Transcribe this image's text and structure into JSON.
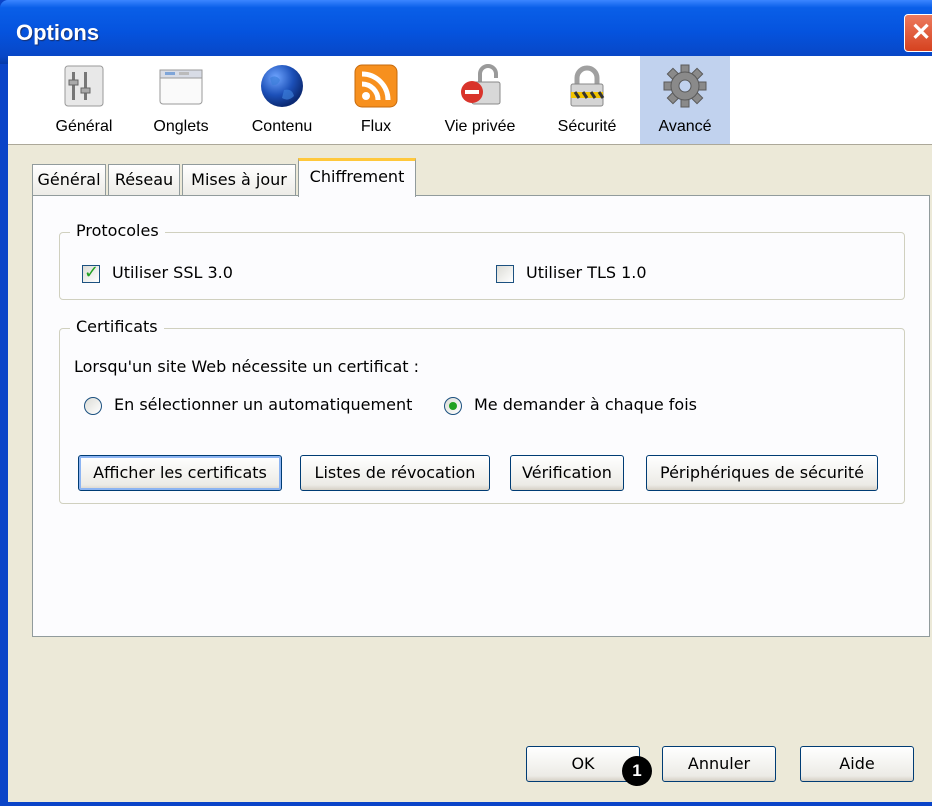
{
  "window": {
    "title": "Options",
    "close_label": "✕"
  },
  "toolbar": {
    "items": [
      {
        "label": "Général",
        "icon": "general-icon"
      },
      {
        "label": "Onglets",
        "icon": "tabs-icon"
      },
      {
        "label": "Contenu",
        "icon": "content-globe-icon"
      },
      {
        "label": "Flux",
        "icon": "rss-feed-icon"
      },
      {
        "label": "Vie privée",
        "icon": "privacy-icon"
      },
      {
        "label": "Sécurité",
        "icon": "padlock-icon"
      },
      {
        "label": "Avancé",
        "icon": "gear-icon",
        "selected": true
      }
    ]
  },
  "tabs": [
    {
      "label": "Général"
    },
    {
      "label": "Réseau"
    },
    {
      "label": "Mises à jour"
    },
    {
      "label": "Chiffrement",
      "active": true
    }
  ],
  "protocols": {
    "legend": "Protocoles",
    "ssl": {
      "label": "Utiliser SSL 3.0",
      "checked": true
    },
    "tls": {
      "label": "Utiliser TLS 1.0",
      "checked": false
    }
  },
  "certificates": {
    "legend": "Certificats",
    "prompt": "Lorsqu'un site Web nécessite un certificat :",
    "option_auto": {
      "label": "En sélectionner un automatiquement",
      "selected": false
    },
    "option_ask": {
      "label": "Me demander à chaque fois",
      "selected": true
    },
    "buttons": {
      "view": "Afficher les certificats",
      "revocation": "Listes de révocation",
      "verification": "Vérification",
      "devices": "Périphériques de sécurité"
    }
  },
  "dialog_buttons": {
    "ok": "OK",
    "cancel": "Annuler",
    "help": "Aide"
  },
  "annotation": {
    "marker": "1"
  },
  "colors": {
    "titlebar": "#0553de",
    "selected_toolbar": "#c1d2ee",
    "active_tab_highlight": "#ffc83c",
    "check": "#21a121"
  }
}
